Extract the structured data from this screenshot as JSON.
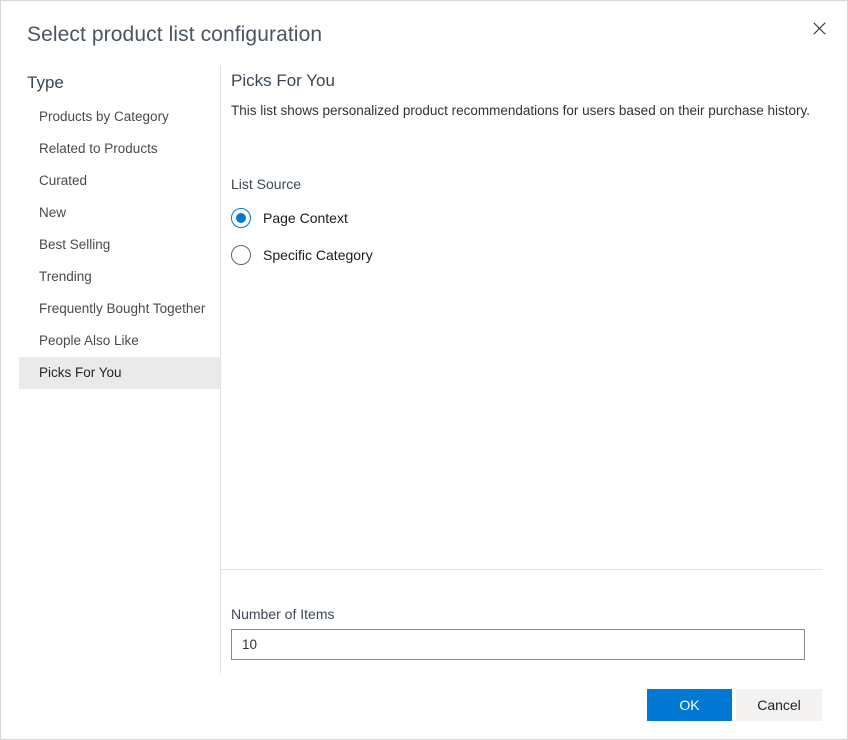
{
  "dialog": {
    "title": "Select product list configuration",
    "close_label": "Close"
  },
  "type_panel": {
    "heading": "Type",
    "items": [
      {
        "label": "Products by Category",
        "selected": false
      },
      {
        "label": "Related to Products",
        "selected": false
      },
      {
        "label": "Curated",
        "selected": false
      },
      {
        "label": "New",
        "selected": false
      },
      {
        "label": "Best Selling",
        "selected": false
      },
      {
        "label": "Trending",
        "selected": false
      },
      {
        "label": "Frequently Bought Together",
        "selected": false
      },
      {
        "label": "People Also Like",
        "selected": false
      },
      {
        "label": "Picks For You",
        "selected": true
      }
    ]
  },
  "detail": {
    "title": "Picks For You",
    "description": "This list shows personalized product recommendations for users based on their purchase history.",
    "list_source": {
      "label": "List Source",
      "options": [
        {
          "label": "Page Context",
          "checked": true
        },
        {
          "label": "Specific Category",
          "checked": false
        }
      ]
    }
  },
  "number_of_items": {
    "label": "Number of Items",
    "value": "10",
    "placeholder": ""
  },
  "footer": {
    "ok_label": "OK",
    "cancel_label": "Cancel"
  },
  "colors": {
    "accent": "#0078d4",
    "selected_row": "#ebeaea",
    "divider": "#e2e2e2",
    "title_text": "#4a5561",
    "cancel_bg": "#f3f2f1"
  }
}
